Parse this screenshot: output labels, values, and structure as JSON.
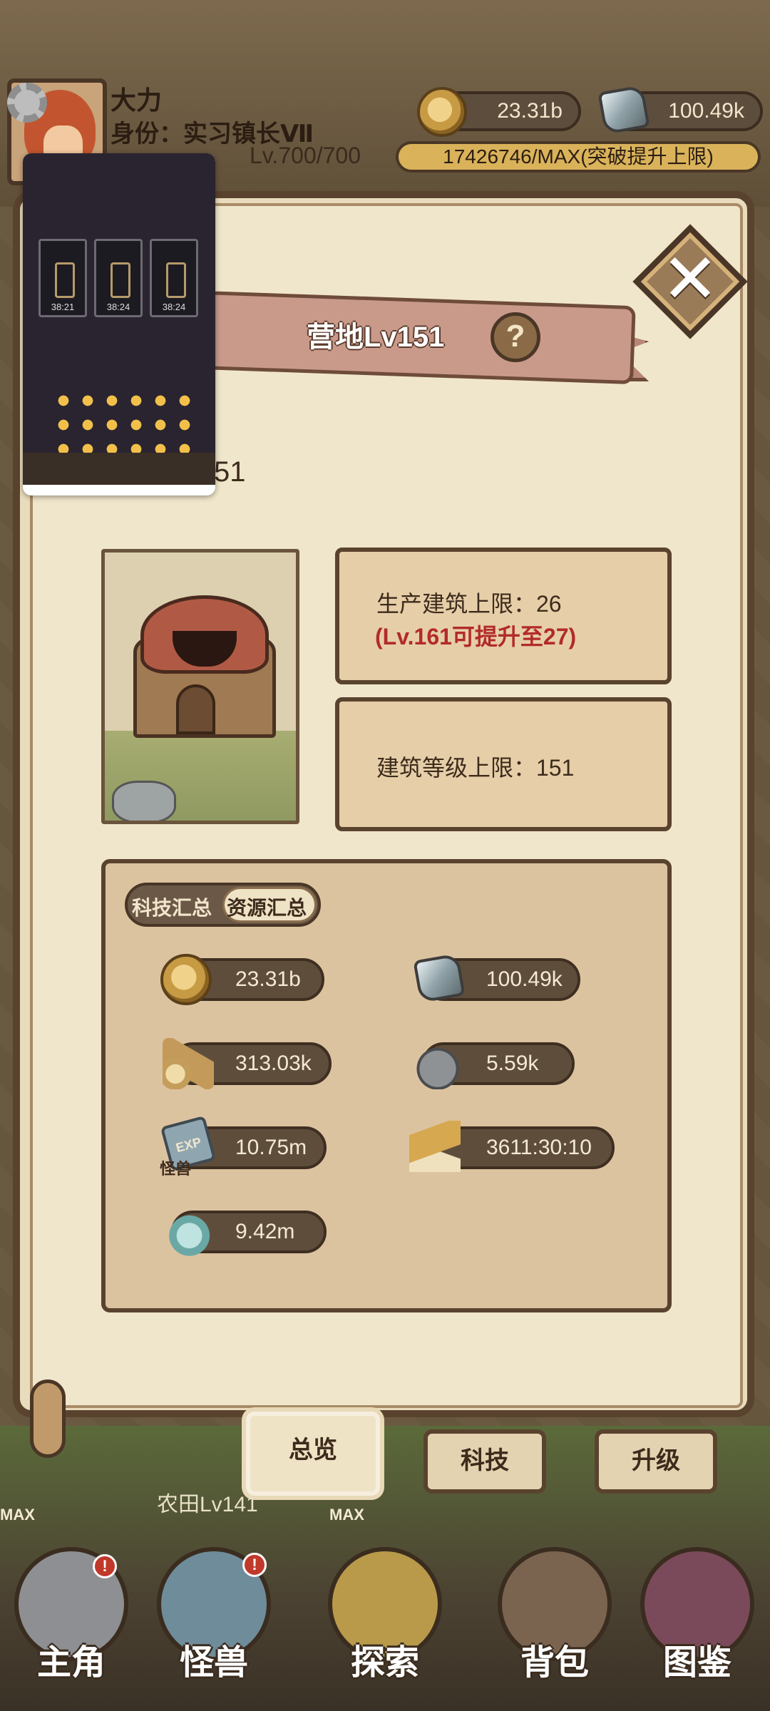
{
  "player": {
    "name": "大力",
    "identity": "身份：实习镇长Ⅶ",
    "level": "Lv.700/700",
    "exp": "17426746/MAX(突破提升上限)"
  },
  "top_resources": {
    "coins": "23.31b",
    "ore": "100.49k"
  },
  "panel": {
    "title": "营地Lv151",
    "help": "?",
    "close": "✕",
    "level_partial": "51"
  },
  "info": {
    "production_limit": "生产建筑上限：26",
    "upgrade_hint": "(Lv.161可提升至27)",
    "building_level_limit": "建筑等级上限：151"
  },
  "summary_tabs": {
    "tech": "科技汇总",
    "resources": "资源汇总"
  },
  "resources": {
    "coins": "23.31b",
    "ore": "100.49k",
    "wood": "313.03k",
    "stone": "5.59k",
    "monster_exp": "10.75m",
    "monster_exp_icon_text": "EXP",
    "monster_exp_icon_label": "怪兽",
    "time": "3611:30:10",
    "water": "9.42m"
  },
  "bottom_tabs": {
    "overview": "总览",
    "tech": "科技",
    "upgrade": "升级"
  },
  "background_labels": {
    "farm": "农田Lv141",
    "max_left": "MAX",
    "max_mid": "MAX"
  },
  "nav": {
    "hero": "主角",
    "monster": "怪兽",
    "explore": "探索",
    "bag": "背包",
    "atlas": "图鉴"
  },
  "mini_window": {
    "timer_1": "38:21",
    "timer_2": "38:24",
    "timer_3": "38:24"
  },
  "colors": {
    "panel_bg": "#f0e6cb",
    "border_brown": "#5a432e",
    "hint_red": "#b22b2b",
    "pill_dark": "#5f4d3c"
  }
}
